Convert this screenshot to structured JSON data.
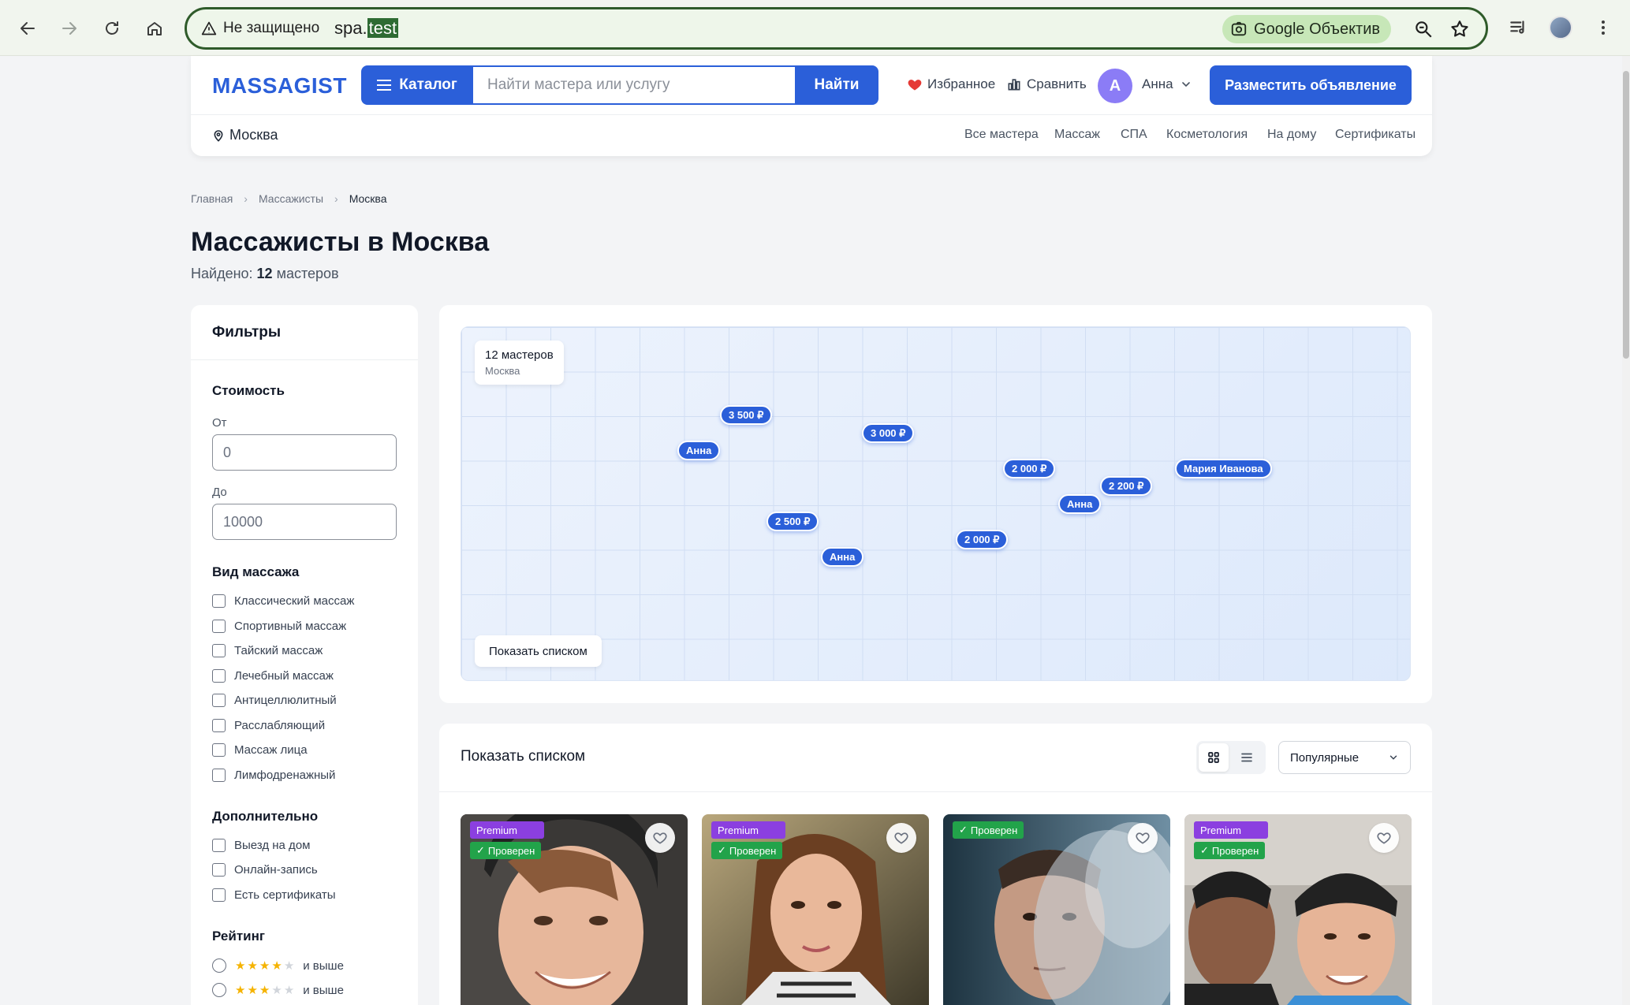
{
  "browser": {
    "security_label": "Не защищено",
    "url_prefix": "spa.",
    "url_highlight": "test",
    "lens_label": "Google Объектив"
  },
  "header": {
    "logo": "MASSAGIST",
    "catalog_label": "Каталог",
    "search_placeholder": "Найти мастера или услугу",
    "search_button": "Найти",
    "favorites_label": "Избранное",
    "compare_label": "Сравнить",
    "user_initial": "А",
    "user_name": "Анна",
    "post_ad_label": "Разместить объявление",
    "city": "Москва",
    "nav": [
      "Все мастера",
      "Массаж",
      "СПА",
      "Косметология",
      "На дому",
      "Сертификаты"
    ]
  },
  "breadcrumb": [
    "Главная",
    "Массажисты",
    "Москва"
  ],
  "page": {
    "title": "Массажисты в Москва",
    "found_prefix": "Найдено:",
    "found_count": "12",
    "found_suffix": "мастеров"
  },
  "filters": {
    "title": "Фильтры",
    "price_section": "Стоимость",
    "from_label": "От",
    "from_value": "0",
    "to_label": "До",
    "to_value": "10000",
    "type_section": "Вид массажа",
    "types": [
      "Классический массаж",
      "Спортивный массаж",
      "Тайский массаж",
      "Лечебный массаж",
      "Антицеллюлитный",
      "Расслабляющий",
      "Массаж лица",
      "Лимфодренажный"
    ],
    "extra_section": "Дополнительно",
    "extras": [
      "Выезд на дом",
      "Онлайн-запись",
      "Есть сертификаты"
    ],
    "rating_section": "Рейтинг",
    "ratings": [
      {
        "stars": 4,
        "label": "и выше"
      },
      {
        "stars": 3,
        "label": "и выше"
      }
    ]
  },
  "map": {
    "count_label": "12 мастеров",
    "city_label": "Москва",
    "pins": [
      "3 500 ₽",
      "Анна",
      "3 000 ₽",
      "2 000 ₽",
      "2 200 ₽",
      "Мария Иванова",
      "Анна",
      "2 500 ₽",
      "2 000 ₽",
      "Анна"
    ],
    "show_list_button": "Показать списком"
  },
  "listing": {
    "title": "Показать списком",
    "sort_value": "Популярные",
    "premium_label": "Premium",
    "verified_label": "Проверен"
  },
  "colors": {
    "brand": "#2b5fd9",
    "premium": "#8b3fe0",
    "verified": "#22a34a"
  }
}
